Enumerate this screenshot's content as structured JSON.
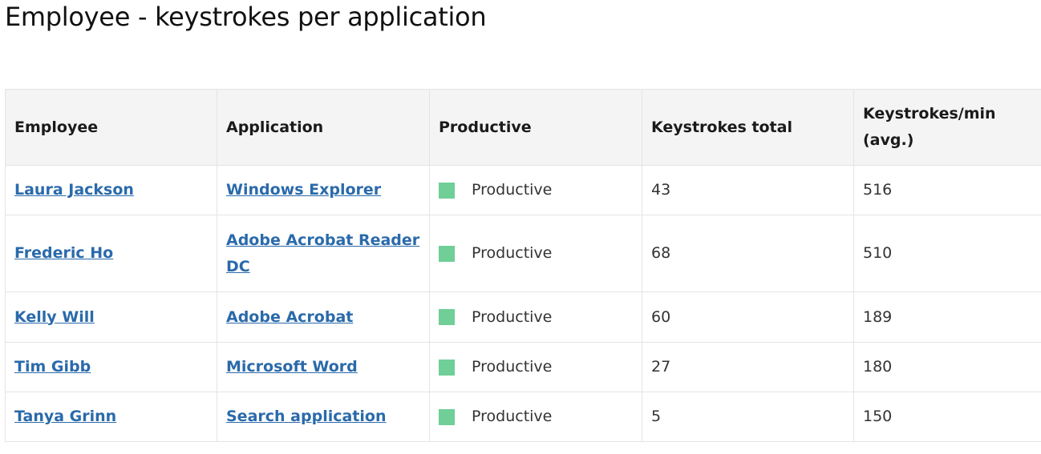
{
  "page_title": "Employee - keystrokes per application",
  "colors": {
    "link": "#2a6aaa",
    "productive": "#6fcf97"
  },
  "table": {
    "headers": [
      "Employee",
      "Application",
      "Productive",
      "Keystrokes total",
      "Keystrokes/min (avg.)"
    ],
    "rows": [
      {
        "employee": "Laura Jackson",
        "application": "Windows Explorer",
        "productive": "Productive",
        "total": "43",
        "per_min": "516"
      },
      {
        "employee": "Frederic Ho",
        "application": "Adobe Acrobat Reader DC",
        "productive": "Productive",
        "total": "68",
        "per_min": "510"
      },
      {
        "employee": "Kelly Will",
        "application": "Adobe Acrobat",
        "productive": "Productive",
        "total": "60",
        "per_min": "189"
      },
      {
        "employee": "Tim Gibb",
        "application": "Microsoft Word",
        "productive": "Productive",
        "total": "27",
        "per_min": "180"
      },
      {
        "employee": "Tanya Grinn",
        "application": "Search application",
        "productive": "Productive",
        "total": "5",
        "per_min": "150"
      }
    ]
  }
}
